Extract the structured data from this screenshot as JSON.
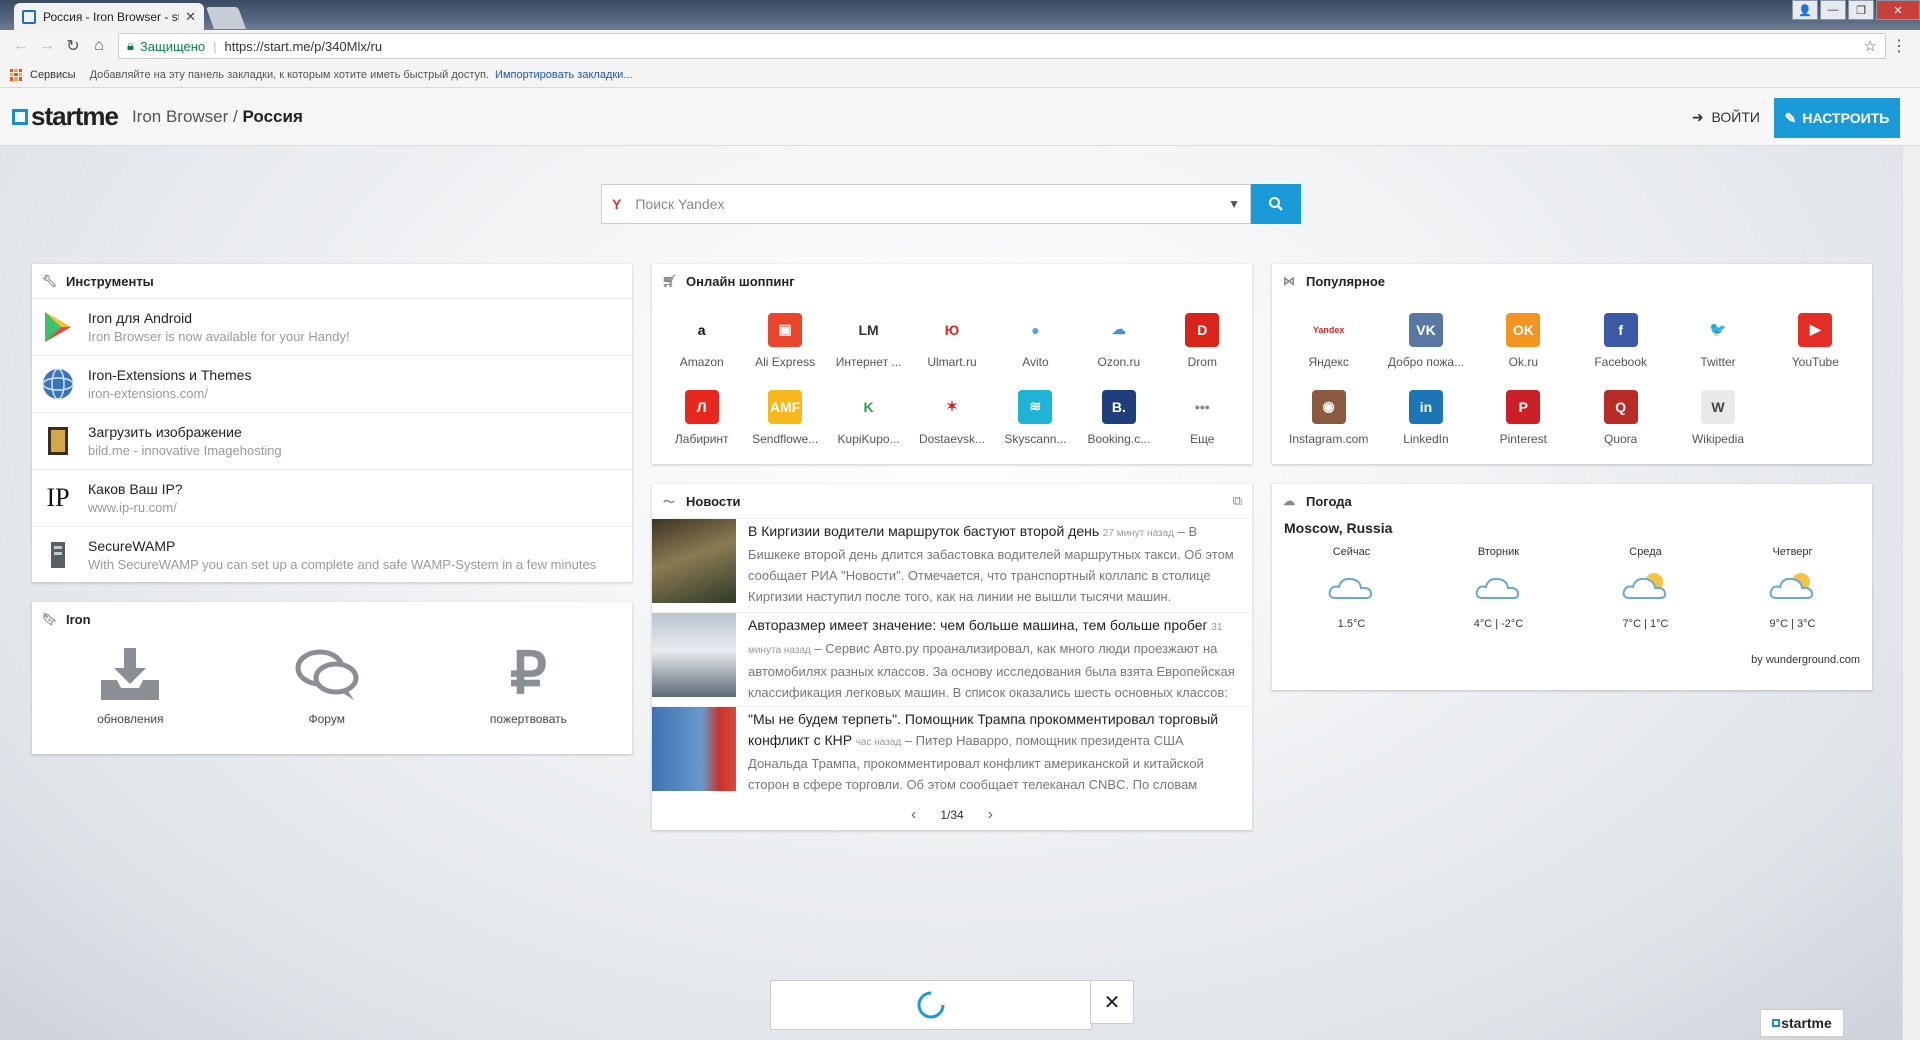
{
  "browser": {
    "tab_title": "Россия - Iron Browser - start.me",
    "url": "https://start.me/p/340Mlx/ru",
    "secure_label": "Защищено",
    "bookmarks": {
      "services": "Сервисы",
      "hint": "Добавляйте на эту панель закладки, к которым хотите иметь быстрый доступ.",
      "import": "Импортировать закладки..."
    }
  },
  "header": {
    "logo": "startme",
    "page_owner": "Iron Browser",
    "separator": "/",
    "page_name": "Россия",
    "login_label": "ВОЙТИ",
    "customize_label": "НАСТРОИТЬ"
  },
  "search": {
    "engine_icon": "Y",
    "placeholder": "Поиск Yandex"
  },
  "tools": {
    "title": "Инструменты",
    "items": [
      {
        "title": "Iron для Android",
        "subtitle": "Iron Browser is now available for your Handy!",
        "icon": "play-store-icon"
      },
      {
        "title": "Iron-Extensions и Themes",
        "subtitle": "iron-extensions.com/",
        "icon": "globe-icon"
      },
      {
        "title": "Загрузить изображение",
        "subtitle": "bild.me - innovative Imagehosting",
        "icon": "image-upload-icon"
      },
      {
        "title": "Каков Ваш IP?",
        "subtitle": "www.ip-ru.com/",
        "icon": "ip-icon",
        "icon_text": "IP"
      },
      {
        "title": "SecureWAMP",
        "subtitle": "With SecureWAMP you can set up a complete and safe WAMP-System in a few minutes",
        "icon": "server-icon"
      }
    ]
  },
  "iron": {
    "title": "Iron",
    "items": [
      {
        "label": "обновления",
        "icon": "download-icon"
      },
      {
        "label": "Форум",
        "icon": "chat-bubbles-icon"
      },
      {
        "label": "пожертвовать",
        "icon": "ruble-icon",
        "glyph": "₽"
      }
    ]
  },
  "shopping": {
    "title": "Онлайн шоппинг",
    "items": [
      {
        "label": "Amazon",
        "glyph": "a",
        "color": "#ffffff",
        "fg": "#111111"
      },
      {
        "label": "Ali Express",
        "glyph": "▣",
        "color": "#e8452c",
        "fg": "#ffffff"
      },
      {
        "label": "Интернет ...",
        "glyph": "LM",
        "color": "#ffffff",
        "fg": "#333333"
      },
      {
        "label": "Ulmart.ru",
        "glyph": "Ю",
        "color": "#ffffff",
        "fg": "#e2231a"
      },
      {
        "label": "Avito",
        "glyph": "●",
        "color": "#ffffff",
        "fg": "#5c9de0"
      },
      {
        "label": "Ozon.ru",
        "glyph": "☁",
        "color": "#ffffff",
        "fg": "#4a90c8"
      },
      {
        "label": "Drom",
        "glyph": "D",
        "color": "#d9241c",
        "fg": "#ffffff"
      },
      {
        "label": "Лабиринт",
        "glyph": "Л",
        "color": "#e8281f",
        "fg": "#ffffff"
      },
      {
        "label": "Sendflowe...",
        "glyph": "AMF",
        "color": "#f6b81d",
        "fg": "#ffffff"
      },
      {
        "label": "KupiKupo...",
        "glyph": "K",
        "color": "#ffffff",
        "fg": "#2aa34a"
      },
      {
        "label": "Dostaevsk...",
        "glyph": "✶",
        "color": "#ffffff",
        "fg": "#c62828"
      },
      {
        "label": "Skyscann...",
        "glyph": "≋",
        "color": "#1fb3d8",
        "fg": "#ffffff"
      },
      {
        "label": "Booking.c...",
        "glyph": "B.",
        "color": "#1e3f7a",
        "fg": "#ffffff"
      },
      {
        "label": "Еще",
        "glyph": "•••",
        "color": "#ffffff",
        "fg": "#888888"
      }
    ]
  },
  "popular": {
    "title": "Популярное",
    "items": [
      {
        "label": "Яндекс",
        "glyph": "Yandex",
        "color": "#ffffff",
        "fg": "#d12b26"
      },
      {
        "label": "Добро пожа...",
        "glyph": "VK",
        "color": "#5878a3",
        "fg": "#ffffff"
      },
      {
        "label": "Ok.ru",
        "glyph": "OK",
        "color": "#f29420",
        "fg": "#ffffff"
      },
      {
        "label": "Facebook",
        "glyph": "f",
        "color": "#3b5aa6",
        "fg": "#ffffff"
      },
      {
        "label": "Twitter",
        "glyph": "🐦",
        "color": "#ffffff",
        "fg": "#48a1e6"
      },
      {
        "label": "YouTube",
        "glyph": "▶",
        "color": "#e52d27",
        "fg": "#ffffff"
      },
      {
        "label": "Instagram.com",
        "glyph": "◉",
        "color": "#8a5b3e",
        "fg": "#ffffff"
      },
      {
        "label": "LinkedIn",
        "glyph": "in",
        "color": "#1c75b4",
        "fg": "#ffffff"
      },
      {
        "label": "Pinterest",
        "glyph": "P",
        "color": "#cb2027",
        "fg": "#ffffff"
      },
      {
        "label": "Quora",
        "glyph": "Q",
        "color": "#b92b27",
        "fg": "#ffffff"
      },
      {
        "label": "Wikipedia",
        "glyph": "W",
        "color": "#e9e9e9",
        "fg": "#444444"
      }
    ]
  },
  "news": {
    "title": "Новости",
    "pager": "1/34",
    "items": [
      {
        "headline": "В Киргизии водители маршруток бастуют второй день",
        "time": "27 минут назад",
        "text": " – В Бишкеке второй день длится забастовка водителей маршрутных такси. Об этом сообщает РИА \"Новости\". Отмечается, что транспортный коллапс в столице Киргизии наступил после того, как на линии не вышли тысячи машин. Требование...",
        "img": "#6a5a3a"
      },
      {
        "headline": "Авторазмер имеет значение: чем больше машина, тем больше пробег",
        "time": "31 минута назад",
        "text": " – Сервис Авто.ру проанализировал, как много люди проезжают на автомобилях разных классов. За основу исследования была взята Европейская классификация легковых машин. В список оказались шесть основных классов: А...",
        "img": "#8b9aa8"
      },
      {
        "headline": "\"Мы не будем терпеть\". Помощник Трампа прокомментировал торговый конфликт с КНР",
        "time": "час назад",
        "text": " – Питер Наварро, помощник президента США Дональда Трампа, прокомментировал конфликт американской и китайской сторон в сфере торговли. Об этом сообщает телеканал CNBC. По словам Наварро, власти США...",
        "img": "#4b6e9a"
      }
    ]
  },
  "weather": {
    "title": "Погода",
    "location": "Moscow, Russia",
    "days": [
      {
        "name": "Сейчас",
        "temp": "1.5°C",
        "icon": "cloud-icon",
        "sun": false
      },
      {
        "name": "Вторник",
        "temp": "4°C | -2°C",
        "icon": "cloud-icon",
        "sun": false
      },
      {
        "name": "Среда",
        "temp": "7°C | 1°C",
        "icon": "partly-cloudy-icon",
        "sun": true
      },
      {
        "name": "Четверг",
        "temp": "9°C | 3°C",
        "icon": "partly-cloudy-icon",
        "sun": true
      }
    ],
    "credit": "by wunderground.com"
  },
  "footer": {
    "logo": "startme"
  }
}
